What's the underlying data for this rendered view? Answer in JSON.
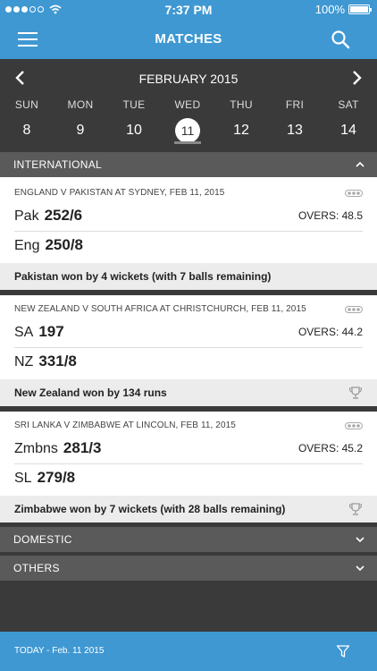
{
  "status": {
    "time": "7:37 PM",
    "battery": "100%"
  },
  "header": {
    "title": "MATCHES"
  },
  "calendar": {
    "month": "FEBRUARY 2015",
    "days": [
      {
        "name": "SUN",
        "date": "8"
      },
      {
        "name": "MON",
        "date": "9"
      },
      {
        "name": "TUE",
        "date": "10"
      },
      {
        "name": "WED",
        "date": "11"
      },
      {
        "name": "THU",
        "date": "12"
      },
      {
        "name": "FRI",
        "date": "13"
      },
      {
        "name": "SAT",
        "date": "14"
      }
    ],
    "selected_index": 3
  },
  "sections": {
    "international": "INTERNATIONAL",
    "domestic": "DOMESTIC",
    "others": "OTHERS"
  },
  "matches": [
    {
      "title": "ENGLAND V PAKISTAN AT SYDNEY, FEB 11, 2015",
      "team1": "Pak",
      "score1": "252/6",
      "overs": "OVERS: 48.5",
      "team2": "Eng",
      "score2": "250/8",
      "result": "Pakistan won by 4 wickets (with 7 balls remaining)"
    },
    {
      "title": "NEW ZEALAND V SOUTH AFRICA AT CHRISTCHURCH, FEB 11, 2015",
      "team1": "SA",
      "score1": "197",
      "overs": "OVERS: 44.2",
      "team2": "NZ",
      "score2": "331/8",
      "result": "New Zealand won by 134 runs"
    },
    {
      "title": "SRI LANKA V ZIMBABWE AT LINCOLN, FEB 11, 2015",
      "team1": "Zmbns",
      "score1": "281/3",
      "overs": "OVERS: 45.2",
      "team2": "SL",
      "score2": "279/8",
      "result": "Zimbabwe won by 7 wickets (with 28 balls remaining)"
    }
  ],
  "footer": {
    "label": "TODAY - Feb. 11 2015"
  },
  "colors": {
    "brand": "#3f98d2",
    "dark": "#3a3a3a",
    "section": "#5a5a5a"
  }
}
